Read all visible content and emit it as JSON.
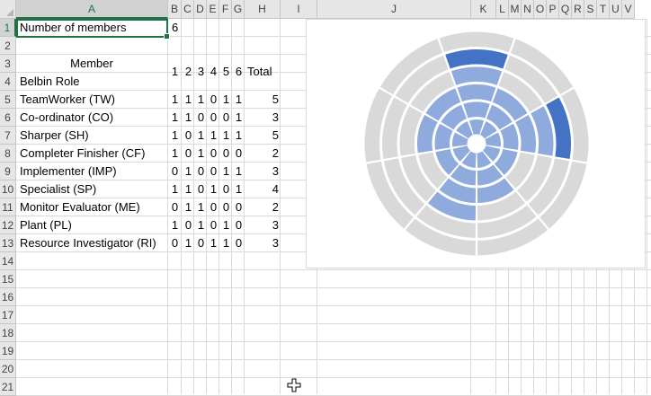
{
  "columns": [
    "A",
    "B",
    "C",
    "D",
    "E",
    "F",
    "G",
    "H",
    "I",
    "J",
    "K",
    "L",
    "M",
    "N",
    "O",
    "P",
    "Q",
    "R",
    "S",
    "T",
    "U",
    "V"
  ],
  "rows": [
    "1",
    "2",
    "3",
    "4",
    "5",
    "6",
    "7",
    "8",
    "9",
    "10",
    "11",
    "12",
    "13",
    "14",
    "15",
    "16",
    "17",
    "18",
    "19",
    "20",
    "21"
  ],
  "members_label": "Number of members",
  "members_count": "6",
  "member_header": "Member",
  "role_header": "Belbin Role",
  "member_numbers": [
    "1",
    "2",
    "3",
    "4",
    "5",
    "6"
  ],
  "total_header": "Total",
  "roles": [
    {
      "name": "TeamWorker (TW)",
      "scores": [
        "1",
        "1",
        "1",
        "0",
        "1",
        "1"
      ],
      "total": "5"
    },
    {
      "name": "Co-ordinator (CO)",
      "scores": [
        "1",
        "1",
        "0",
        "0",
        "0",
        "1"
      ],
      "total": "3"
    },
    {
      "name": "Sharper (SH)",
      "scores": [
        "1",
        "0",
        "1",
        "1",
        "1",
        "1"
      ],
      "total": "5"
    },
    {
      "name": "Completer Finisher (CF)",
      "scores": [
        "1",
        "0",
        "1",
        "0",
        "0",
        "0"
      ],
      "total": "2"
    },
    {
      "name": "Implementer (IMP)",
      "scores": [
        "0",
        "1",
        "0",
        "0",
        "1",
        "1"
      ],
      "total": "3"
    },
    {
      "name": "Specialist (SP)",
      "scores": [
        "1",
        "1",
        "0",
        "1",
        "0",
        "1"
      ],
      "total": "4"
    },
    {
      "name": "Monitor Evaluator (ME)",
      "scores": [
        "0",
        "1",
        "1",
        "0",
        "0",
        "0"
      ],
      "total": "2"
    },
    {
      "name": "Plant (PL)",
      "scores": [
        "1",
        "0",
        "1",
        "0",
        "1",
        "0"
      ],
      "total": "3"
    },
    {
      "name": "Resource Investigator (RI)",
      "scores": [
        "0",
        "1",
        "0",
        "1",
        "1",
        "0"
      ],
      "total": "3"
    }
  ],
  "chart_data": {
    "type": "radial-bar",
    "rings": 6,
    "categories": [
      "TW",
      "CO",
      "SH",
      "CF",
      "IMP",
      "SP",
      "ME",
      "PL",
      "RI"
    ],
    "values": [
      5,
      3,
      5,
      2,
      3,
      4,
      2,
      3,
      3
    ],
    "colors": {
      "filled_dark": "#4472c4",
      "filled_light": "#8faadc",
      "empty": "#d9d9d9"
    }
  }
}
